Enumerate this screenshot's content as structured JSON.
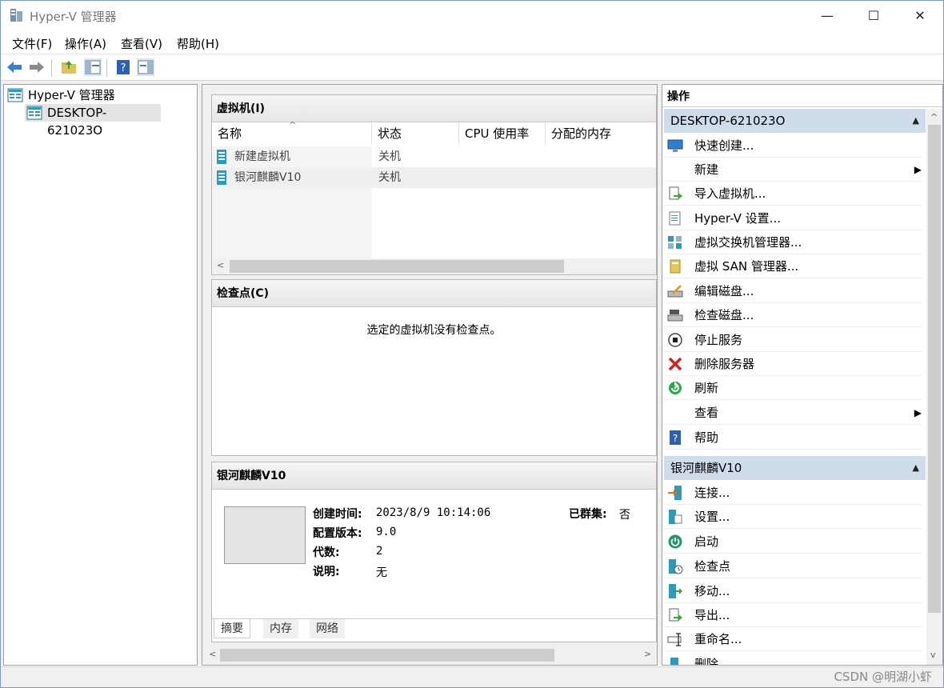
{
  "window": {
    "title": "Hyper-V 管理器",
    "minimize": "—",
    "maximize": "☐",
    "close": "✕"
  },
  "menu": [
    "文件(F)",
    "操作(A)",
    "查看(V)",
    "帮助(H)"
  ],
  "tree": {
    "root": "Hyper-V 管理器",
    "server": "DESKTOP-621023O"
  },
  "vm_panel": {
    "title": "虚拟机(I)",
    "columns": [
      "名称",
      "状态",
      "CPU 使用率",
      "分配的内存"
    ],
    "sort_indicator": "^",
    "rows": [
      {
        "name": "新建虚拟机",
        "state": "关机"
      },
      {
        "name": "银河麒麟V10",
        "state": "关机"
      }
    ]
  },
  "checkpoint_panel": {
    "title": "检查点(C)",
    "message": "选定的虚拟机没有检查点。"
  },
  "detail_panel": {
    "title": "银河麒麟V10",
    "created_label": "创建时间:",
    "created_value": "2023/8/9 10:14:06",
    "clustered_label": "已群集:",
    "clustered_value": "否",
    "config_label": "配置版本:",
    "config_value": "9.0",
    "gen_label": "代数:",
    "gen_value": "2",
    "notes_label": "说明:",
    "notes_value": "无",
    "tabs": [
      "摘要",
      "内存",
      "网络"
    ]
  },
  "actions": {
    "title": "操作",
    "server_group": "DESKTOP-621023O",
    "server_items": [
      "快速创建...",
      "新建",
      "导入虚拟机...",
      "Hyper-V 设置...",
      "虚拟交换机管理器...",
      "虚拟 SAN 管理器...",
      "编辑磁盘...",
      "检查磁盘...",
      "停止服务",
      "删除服务器",
      "刷新",
      "查看",
      "帮助"
    ],
    "vm_group": "银河麒麟V10",
    "vm_items": [
      "连接...",
      "设置...",
      "启动",
      "检查点",
      "移动...",
      "导出...",
      "重命名...",
      "删除..."
    ]
  },
  "watermark": "CSDN @明湖小虾"
}
